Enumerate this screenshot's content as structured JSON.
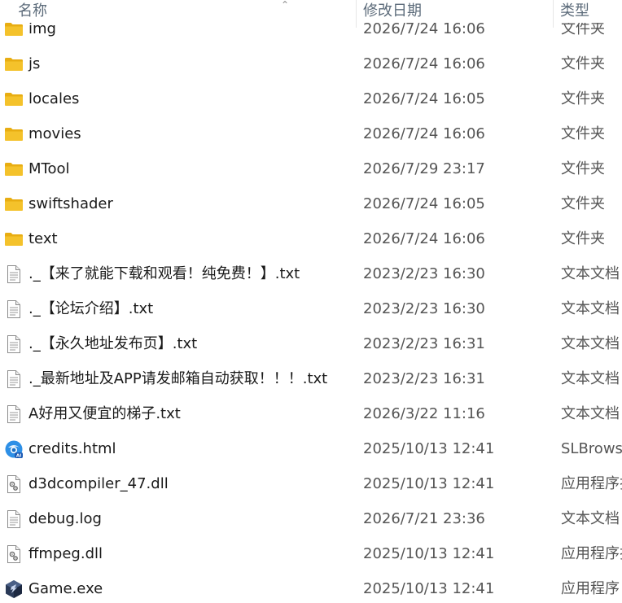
{
  "columns": {
    "name": "名称",
    "date": "修改日期",
    "type": "类型"
  },
  "files": [
    {
      "name": "img",
      "date": "2026/7/24 16:06",
      "type": "文件夹",
      "icon": "folder"
    },
    {
      "name": "js",
      "date": "2026/7/24 16:06",
      "type": "文件夹",
      "icon": "folder"
    },
    {
      "name": "locales",
      "date": "2026/7/24 16:05",
      "type": "文件夹",
      "icon": "folder"
    },
    {
      "name": "movies",
      "date": "2026/7/24 16:06",
      "type": "文件夹",
      "icon": "folder"
    },
    {
      "name": "MTool",
      "date": "2026/7/29 23:17",
      "type": "文件夹",
      "icon": "folder"
    },
    {
      "name": "swiftshader",
      "date": "2026/7/24 16:05",
      "type": "文件夹",
      "icon": "folder"
    },
    {
      "name": "text",
      "date": "2026/7/24 16:06",
      "type": "文件夹",
      "icon": "folder"
    },
    {
      "name": "._【来了就能下载和观看！纯免费！】.txt",
      "date": "2023/2/23 16:30",
      "type": "文本文档",
      "icon": "text-file"
    },
    {
      "name": "._【论坛介绍】.txt",
      "date": "2023/2/23 16:30",
      "type": "文本文档",
      "icon": "text-file"
    },
    {
      "name": "._【永久地址发布页】.txt",
      "date": "2023/2/23 16:31",
      "type": "文本文档",
      "icon": "text-file"
    },
    {
      "name": "._最新地址及APP请发邮箱自动获取！！！.txt",
      "date": "2023/2/23 16:31",
      "type": "文本文档",
      "icon": "text-file"
    },
    {
      "name": "A好用又便宜的梯子.txt",
      "date": "2026/3/22 11:16",
      "type": "文本文档",
      "icon": "text-file"
    },
    {
      "name": "credits.html",
      "date": "2025/10/13 12:41",
      "type": "SLBrowser",
      "icon": "browser-file"
    },
    {
      "name": "d3dcompiler_47.dll",
      "date": "2025/10/13 12:41",
      "type": "应用程序扩展",
      "icon": "dll-file"
    },
    {
      "name": "debug.log",
      "date": "2026/7/21 23:36",
      "type": "文本文档",
      "icon": "text-file"
    },
    {
      "name": "ffmpeg.dll",
      "date": "2025/10/13 12:41",
      "type": "应用程序扩展",
      "icon": "dll-file"
    },
    {
      "name": "Game.exe",
      "date": "2025/10/13 12:41",
      "type": "应用程序",
      "icon": "exe-file"
    }
  ],
  "colors": {
    "folder": "#f4c22b",
    "header_text": "#5c6b7a",
    "detail_text": "#555555"
  }
}
